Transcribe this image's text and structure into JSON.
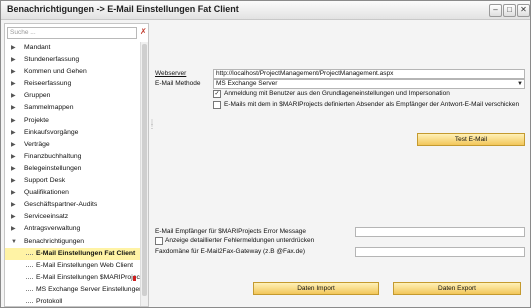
{
  "window": {
    "title": "Benachrichtigungen -> E-Mail Einstellungen Fat Client",
    "minimize_label": "–",
    "maximize_label": "□",
    "close_label": "✕"
  },
  "sidebar": {
    "search_placeholder": "Suche ...",
    "items": [
      {
        "label": "Mandant",
        "arrow": "▶"
      },
      {
        "label": "Stundenerfassung",
        "arrow": "▶"
      },
      {
        "label": "Kommen und Gehen",
        "arrow": "▶"
      },
      {
        "label": "Reiseerfassung",
        "arrow": "▶"
      },
      {
        "label": "Gruppen",
        "arrow": "▶"
      },
      {
        "label": "Sammelmappen",
        "arrow": "▶"
      },
      {
        "label": "Projekte",
        "arrow": "▶"
      },
      {
        "label": "Einkaufsvorgänge",
        "arrow": "▶"
      },
      {
        "label": "Verträge",
        "arrow": "▶"
      },
      {
        "label": "Finanzbuchhaltung",
        "arrow": "▶"
      },
      {
        "label": "Belegeinstellungen",
        "arrow": "▶"
      },
      {
        "label": "Support Desk",
        "arrow": "▶"
      },
      {
        "label": "Qualifikationen",
        "arrow": "▶"
      },
      {
        "label": "Geschäftspartner-Audits",
        "arrow": "▶"
      },
      {
        "label": "Serviceeinsatz",
        "arrow": "▶"
      },
      {
        "label": "Antragsverwaltung",
        "arrow": "▶"
      },
      {
        "label": "Benachrichtigungen",
        "arrow": "▼"
      }
    ],
    "children": [
      {
        "label": "E-Mail Einstellungen Fat Client",
        "selected": true
      },
      {
        "label": "E-Mail Einstellungen Web Client",
        "selected": false
      },
      {
        "label": "E-Mail Einstellungen $MARIProject",
        "selected": false
      },
      {
        "label": "MS Exchange Server Einstellungen",
        "selected": false
      },
      {
        "label": "Protokoll",
        "selected": false
      }
    ]
  },
  "form": {
    "webserver_label": "Webserver",
    "webserver_value": "http://localhost/ProjectManagement/ProjectManagement.aspx",
    "email_method_label": "E-Mail Methode",
    "email_method_value": "MS Exchange Server",
    "checkbox1_label": "Anmeldung mit Benutzer aus den Grundlageneinstellungen und Impersonation",
    "checkbox1_mark": "✓",
    "checkbox2_label": "E-Mails mit dem in $MARIProjects definierten Absender als Empfänger der Antwort-E-Mail verschicken",
    "test_email_button": "Test E-Mail",
    "error_recipient_label": "E-Mail Empfänger für $MARIProjects Error Message",
    "error_recipient_value": "",
    "detailed_errors_label": "Anzeige detaillierter Fehlermeldungen unterdrücken",
    "fax_domain_label": "Faxdomäne für E-Mail2Fax-Gateway (z.B @Fax.de)",
    "fax_domain_value": "",
    "import_button": "Daten Import",
    "export_button": "Daten Export"
  }
}
